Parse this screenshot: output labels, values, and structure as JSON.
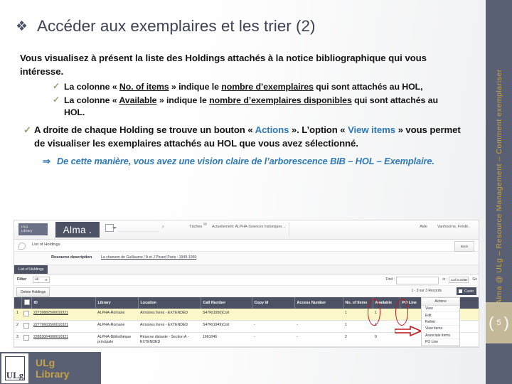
{
  "slide": {
    "title": "Accéder aux exemplaires et les trier (2)",
    "title_bullet": "❖",
    "page_number": "5",
    "bracket_left": "(",
    "bracket_right": ")",
    "side_label": "Alma @ ULg – Resource Management – Comment exemplariser",
    "logo": {
      "line1": "ULg",
      "line2": "Library"
    }
  },
  "body": {
    "intro": "Vous visualisez à présent la liste des Holdings attachés à la notice bibliographique qui vous intéresse.",
    "sub_bullets": [
      {
        "tick": "✓",
        "pre": "La colonne « ",
        "col": "No. of items",
        "mid": " » indique le ",
        "emph": "nombre d’exemplaires",
        "post": " qui sont attachés au HOL,"
      },
      {
        "tick": "✓",
        "pre": "La colonne « ",
        "col": "Available",
        "mid": " » indique le ",
        "emph": "nombre d’exemplaires disponibles",
        "post": " qui sont attachés au HOL."
      }
    ],
    "main_bullet": {
      "tick": "✓",
      "part1": "A droite de chaque Holding se trouve un bouton « ",
      "link1": "Actions",
      "part2": " ». L’option « ",
      "link2": "View items",
      "part3": " » vous permet de visualiser les exemplaires attachés au HOL que vous avez sélectionné."
    },
    "arrow_bullet": {
      "arrow": "⇒",
      "text": "De cette manière, vous avez une vision claire de l’arborescence BIB – HOL – Exemplaire."
    }
  },
  "screenshot": {
    "topbar": {
      "ulg_logo_line1": "ULg",
      "ulg_logo_line2": "Library",
      "alma_logo": "Alma .",
      "search_placeholder": "",
      "search_icon": "⌕",
      "taches": "Tâches",
      "current_scope": "Actuellement: ALPHA-Sciences historiques ..",
      "help": "Aide",
      "user": "Vanhoorne, Frédé.."
    },
    "breadcrumb": {
      "label": "List of Holdings",
      "back_button": "Back"
    },
    "resource": {
      "label": "Resource description",
      "value": "La chanson de Guillaume / A et J Picard Paris : 1949-1950"
    },
    "tab": "List of Holdings",
    "filter": {
      "label": "Filter",
      "value": "All"
    },
    "find": {
      "label": "Find :",
      "value": "",
      "in_label": "in :",
      "in_value": "Call number",
      "go": "Go"
    },
    "toolbar": {
      "delete_button": "Delete Holdings",
      "record_count": "1 - 3 sur 3 Records",
      "customize_button": "Custo"
    },
    "table": {
      "headers": [
        "",
        "",
        "ID",
        "Library",
        "Location",
        "Call Number",
        "Copy Id",
        "Access Number",
        "No. of Items",
        "Available",
        "PO Line",
        ""
      ],
      "rows": [
        {
          "num": "1",
          "id": "22739882500010321",
          "library": "ALPHA-Romane",
          "location": "Armoires livres - EXTENDED",
          "call_number": "S47R(1950)Coll",
          "copy_id": "",
          "access_number": "",
          "no_of_items": "1",
          "available": "1",
          "po_line": ""
        },
        {
          "num": "2",
          "id": "22779603500010321",
          "library": "ALPHA-Romane",
          "location": "Armoires livres - EXTENDED",
          "call_number": "S47R(1949)Coll",
          "copy_id": "-",
          "access_number": "-",
          "no_of_items": "1",
          "available": "1",
          "po_line": ""
        },
        {
          "num": "3",
          "id": "22853064000010321",
          "library": "ALPHA-Bibliothèque principale",
          "location": "Réserve distante - Section A - EXTENDED",
          "call_number": "1661046",
          "copy_id": "-",
          "access_number": "-",
          "no_of_items": "2",
          "available": "0",
          "po_line": ""
        }
      ]
    },
    "actions_menu": {
      "header": "Actions",
      "items": [
        "View",
        "Edit",
        "Relink",
        "View items",
        "Associate items",
        "PO Line"
      ]
    },
    "annotation_color": "#c0171c"
  }
}
